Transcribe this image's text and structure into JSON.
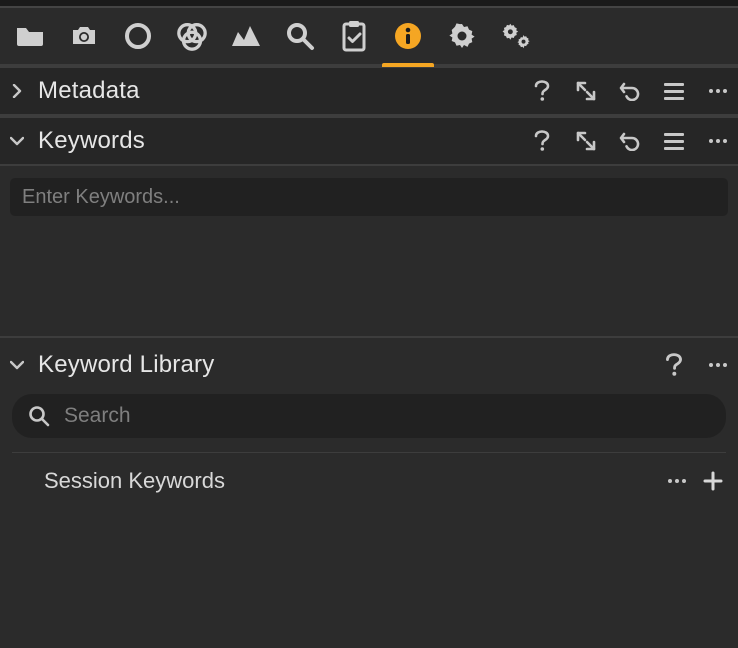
{
  "toolbar": {
    "icons": [
      "folder",
      "camera",
      "circle",
      "color-profile",
      "histogram",
      "magnify",
      "clipboard",
      "info",
      "gear",
      "gears"
    ],
    "active": "info"
  },
  "metadata": {
    "title": "Metadata",
    "expanded": false
  },
  "keywords": {
    "title": "Keywords",
    "expanded": true,
    "input_placeholder": "Enter Keywords..."
  },
  "library": {
    "title": "Keyword Library",
    "expanded": true,
    "search_placeholder": "Search",
    "rows": [
      {
        "label": "Session Keywords"
      }
    ]
  }
}
